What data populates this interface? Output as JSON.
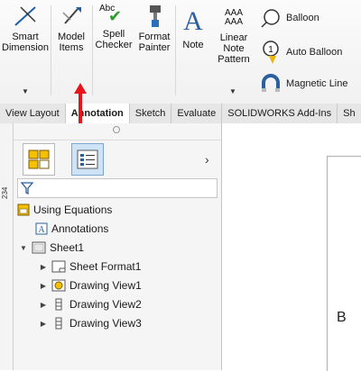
{
  "ribbon": {
    "smart_dimension": "Smart\nDimension",
    "model_items": "Model\nItems",
    "spell_checker": "Spell\nChecker",
    "spell_icon_text": "Abc",
    "format_painter": "Format\nPainter",
    "note": "Note",
    "linear_note_pattern": "Linear\nNote\nPattern",
    "linear_icon_text": "AAA\nAAA",
    "balloon": "Balloon",
    "auto_balloon": "Auto Balloon",
    "magnetic_line": "Magnetic Line",
    "balloon_num": "1"
  },
  "tabs": [
    "View Layout",
    "Annotation",
    "Sketch",
    "Evaluate",
    "SOLIDWORKS Add-Ins",
    "Sh"
  ],
  "ruler_label": "234",
  "tree": {
    "root": "Using Equations",
    "annotations": "Annotations",
    "sheet": "Sheet1",
    "children": [
      "Sheet Format1",
      "Drawing View1",
      "Drawing View2",
      "Drawing View3"
    ]
  },
  "drawing": {
    "zone_label": "B"
  },
  "colors": {
    "accent_arrow": "#e8141a",
    "selected_tab": "#cfe3f6"
  }
}
